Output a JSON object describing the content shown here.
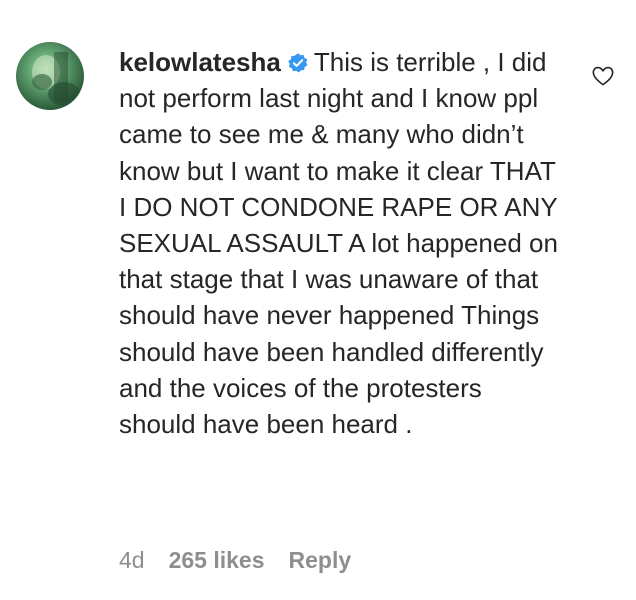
{
  "comment": {
    "username": "kelowlatesha",
    "verified_icon": "verified-badge-icon",
    "text": "This is terrible , I did not perform last night and I know ppl came to see me & many who didn’t know but I want to make it clear THAT I DO NOT CONDONE RAPE OR ANY SEXUAL ASSAULT A lot happened on that stage that I was unaware of that should have never happened Things should have been handled differently and the voices of the protesters should have been heard .",
    "age": "4d",
    "likes": "265 likes",
    "reply_label": "Reply",
    "like_icon": "heart-icon"
  },
  "colors": {
    "text": "#262626",
    "meta": "#8e8e8e",
    "verified": "#3897f0"
  }
}
